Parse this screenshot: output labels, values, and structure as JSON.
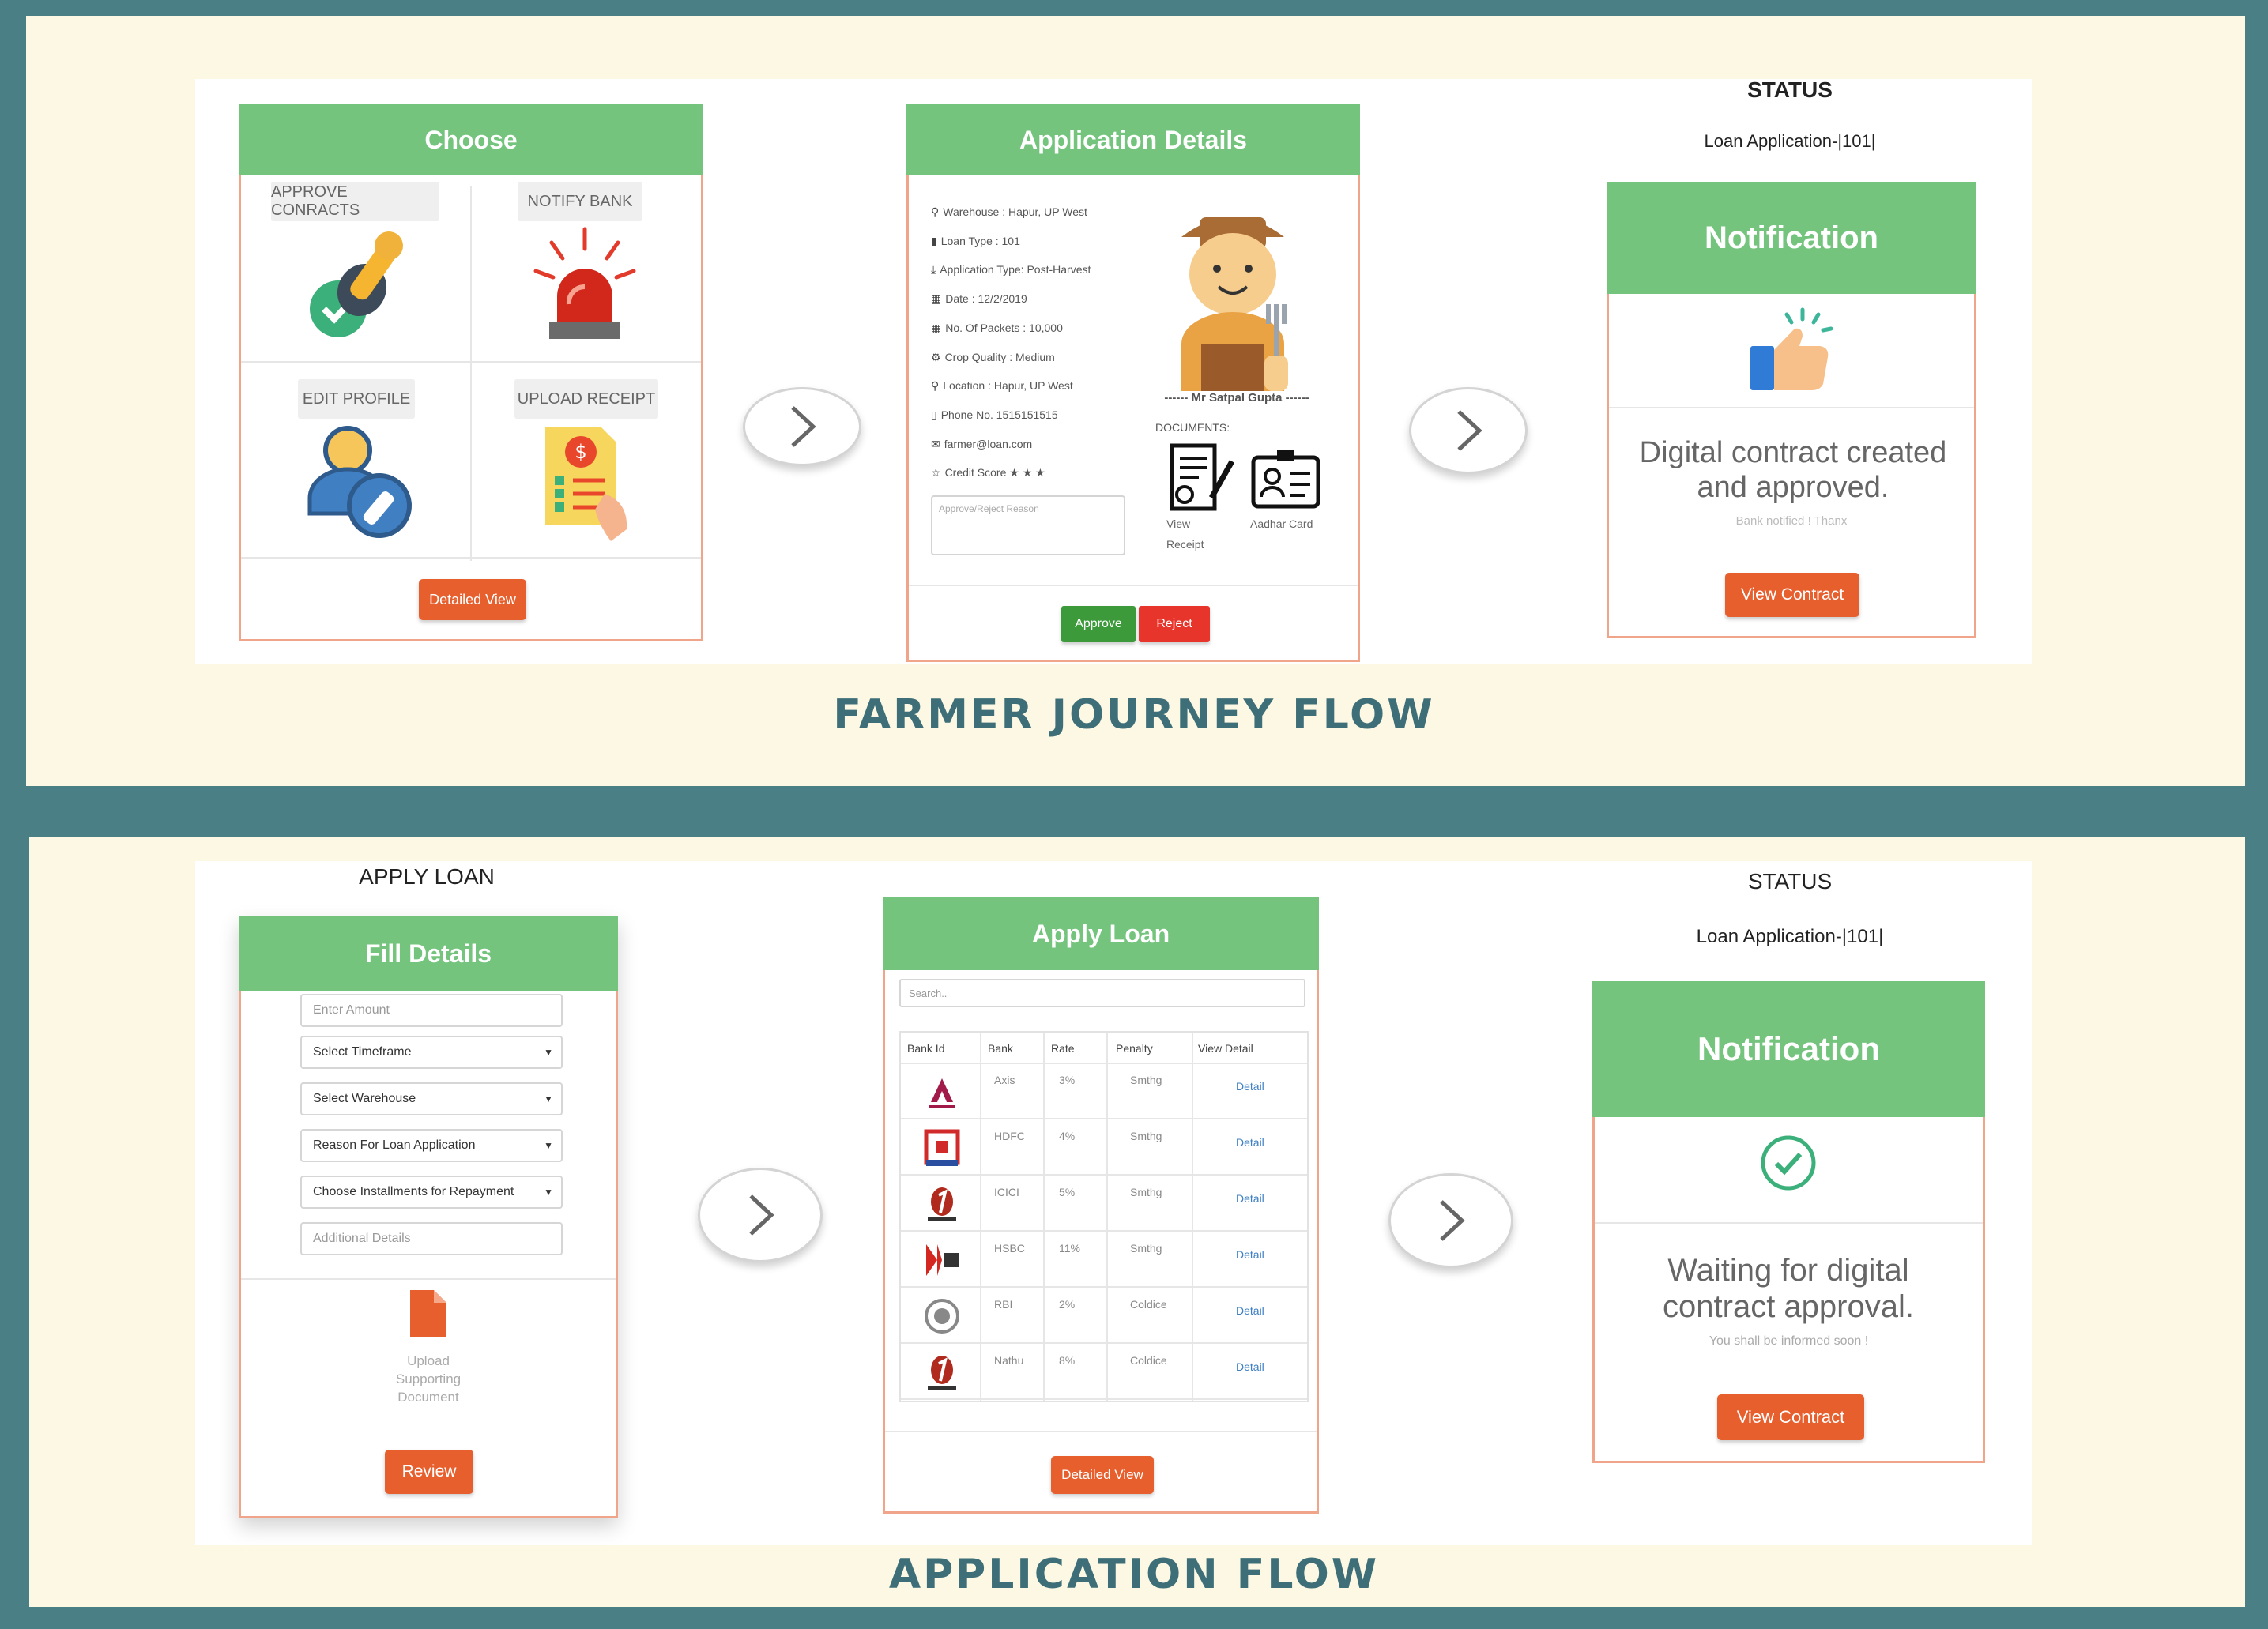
{
  "farmer_flow": {
    "title": "FARMER JOURNEY FLOW",
    "choose_card": {
      "header": "Choose",
      "tiles": [
        {
          "label": "APPROVE CONRACTS"
        },
        {
          "label": "NOTIFY BANK"
        },
        {
          "label": "EDIT PROFILE"
        },
        {
          "label": "UPLOAD RECEIPT"
        }
      ],
      "detailed_view": "Detailed View"
    },
    "application_card": {
      "header": "Application Details",
      "details": [
        {
          "icon": "map-marker-icon",
          "glyph": "⚲",
          "text": "Warehouse : Hapur, UP West"
        },
        {
          "icon": "bookmark-icon",
          "glyph": "▮",
          "text": "Loan Type : 101"
        },
        {
          "icon": "download-icon",
          "glyph": "⤓",
          "text": "Application Type: Post-Harvest"
        },
        {
          "icon": "calendar-icon",
          "glyph": "▦",
          "text": "Date : 12/2/2019"
        },
        {
          "icon": "grid-icon",
          "glyph": "▦",
          "text": "No. Of Packets : 10,000"
        },
        {
          "icon": "gear-icon",
          "glyph": "⚙",
          "text": "Crop Quality : Medium"
        },
        {
          "icon": "map-marker-icon",
          "glyph": "⚲",
          "text": "Location : Hapur, UP West"
        },
        {
          "icon": "phone-icon",
          "glyph": "▯",
          "text": "Phone No. 1515151515"
        },
        {
          "icon": "envelope-icon",
          "glyph": "✉",
          "text": "farmer@loan.com"
        },
        {
          "icon": "star-icon",
          "glyph": "☆",
          "text": "Credit Score ★ ★ ★"
        }
      ],
      "farmer_name": "------ Mr Satpal Gupta ------",
      "documents_label": "DOCUMENTS:",
      "doc_receipt_line1": "View",
      "doc_receipt_line2": "Receipt",
      "doc_aadhar": "Aadhar Card",
      "reason_placeholder": "Approve/Reject Reason",
      "approve": "Approve",
      "reject": "Reject"
    },
    "status": {
      "title": "STATUS",
      "subtitle": "Loan Application-|101|",
      "notification_header": "Notification",
      "message": "Digital contract created and approved.",
      "submessage": "Bank notified ! Thanx",
      "view_contract": "View Contract"
    }
  },
  "application_flow": {
    "title": "APPLICATION FLOW",
    "apply_loan_title": "APPLY LOAN",
    "fill_details": {
      "header": "Fill Details",
      "amount_placeholder": "Enter Amount",
      "timeframe": "Select Timeframe",
      "warehouse": "Select Warehouse",
      "reason": "Reason For Loan Application",
      "installments": "Choose Installments for Repayment",
      "additional_placeholder": "Additional Details",
      "upload_line1": "Upload",
      "upload_line2": "Supporting",
      "upload_line3": "Document",
      "review": "Review"
    },
    "apply_loan_card": {
      "header": "Apply Loan",
      "search_placeholder": "Search..",
      "columns": [
        "Bank Id",
        "Bank",
        "Rate",
        "Penalty",
        "View Detail"
      ],
      "rows": [
        {
          "logo": "axis-logo",
          "bank": "Axis",
          "rate": "3%",
          "penalty": "Smthg",
          "detail": "Detail"
        },
        {
          "logo": "hdfc-logo",
          "bank": "HDFC",
          "rate": "4%",
          "penalty": "Smthg",
          "detail": "Detail"
        },
        {
          "logo": "icici-logo",
          "bank": "ICICI",
          "rate": "5%",
          "penalty": "Smthg",
          "detail": "Detail"
        },
        {
          "logo": "hsbc-logo",
          "bank": "HSBC",
          "rate": "11%",
          "penalty": "Smthg",
          "detail": "Detail"
        },
        {
          "logo": "rbi-logo",
          "bank": "RBI",
          "rate": "2%",
          "penalty": "Coldice",
          "detail": "Detail"
        },
        {
          "logo": "icici-logo",
          "bank": "Nathu",
          "rate": "8%",
          "penalty": "Coldice",
          "detail": "Detail"
        }
      ],
      "detailed_view": "Detailed View"
    },
    "status": {
      "title": "STATUS",
      "subtitle": "Loan Application-|101|",
      "notification_header": "Notification",
      "message": "Waiting for digital contract approval.",
      "submessage": "You shall be informed soon !",
      "view_contract": "View Contract"
    }
  },
  "colors": {
    "frame": "#4a7f86",
    "band": "#fdf8e4",
    "header_green": "#74c47e",
    "accent_orange": "#e85f2e",
    "approve_green": "#3c9a3a",
    "reject_red": "#e8352c",
    "title_teal": "#3e6f78"
  }
}
